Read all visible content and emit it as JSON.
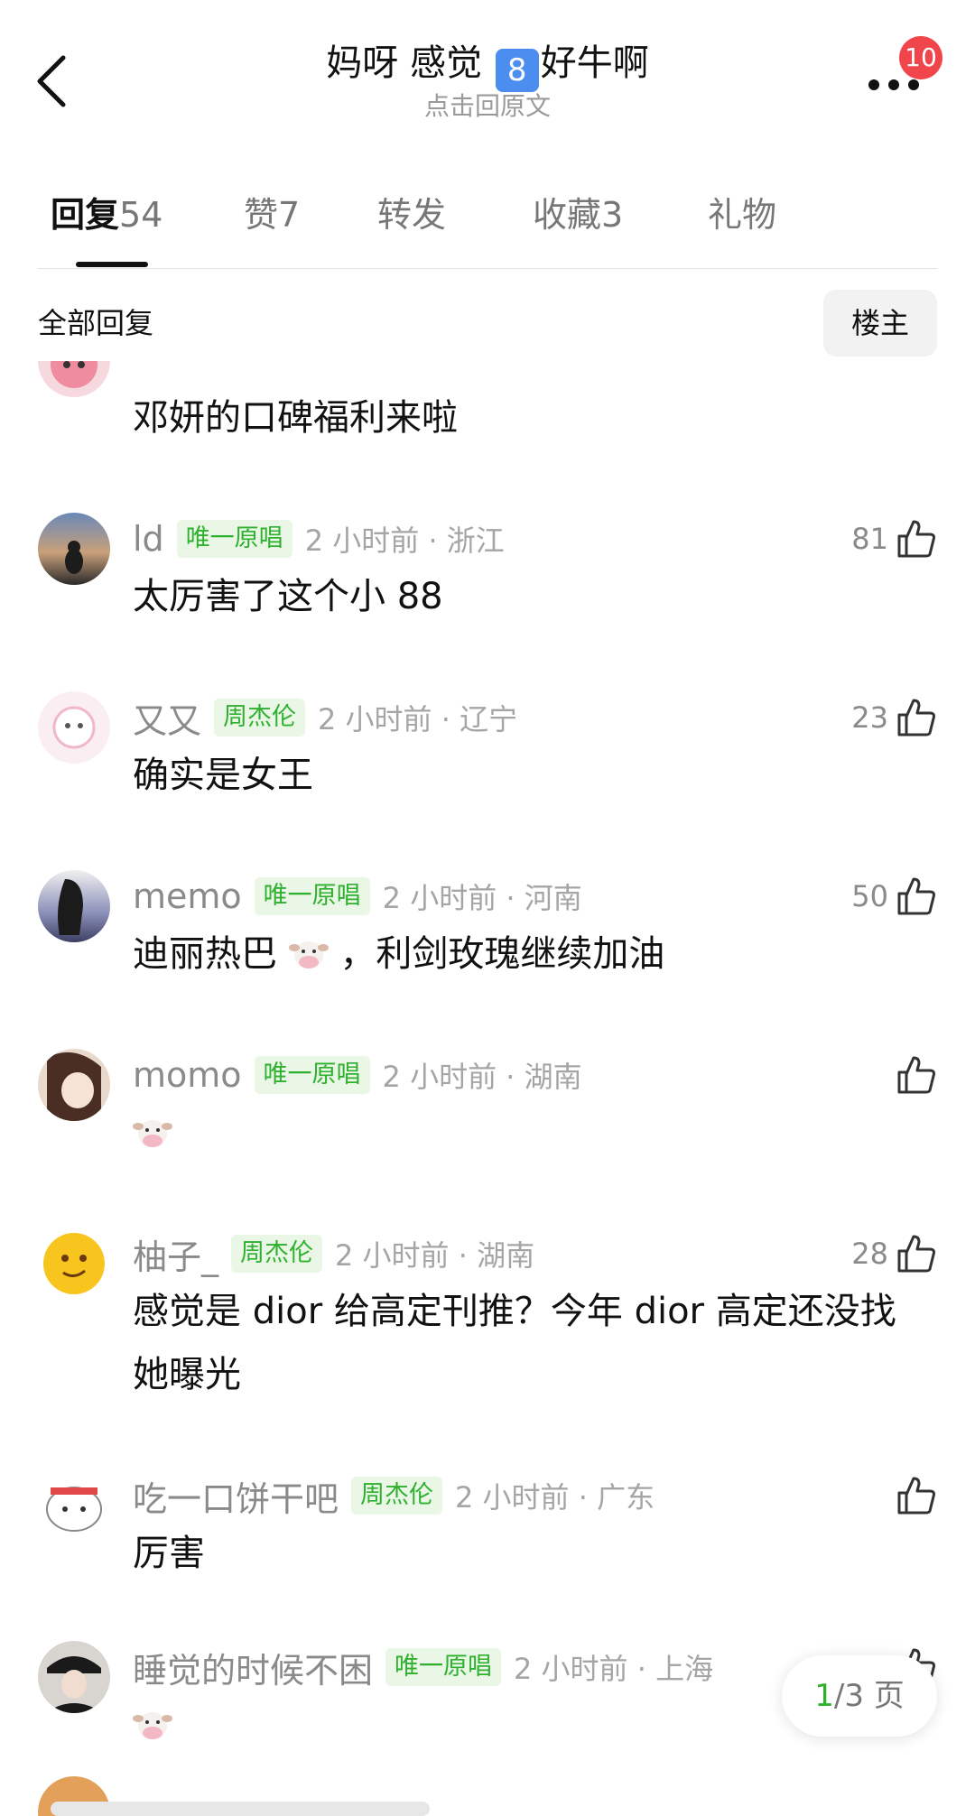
{
  "header": {
    "title_before": "妈呀 感觉",
    "title_badge": "8",
    "title_after": "好牛啊",
    "subtitle": "点击回原文",
    "notification_count": "10"
  },
  "tabs": [
    {
      "label": "回复",
      "count": "54"
    },
    {
      "label": "赞",
      "count": "7"
    },
    {
      "label": "转发",
      "count": ""
    },
    {
      "label": "收藏",
      "count": "3"
    },
    {
      "label": "礼物",
      "count": ""
    }
  ],
  "section": {
    "title": "全部回复",
    "op_filter": "楼主"
  },
  "comments": [
    {
      "text": "邓妍的口碑福利来啦"
    },
    {
      "name": "ld",
      "tag": "唯一原唱",
      "time": "2 小时前 · 浙江",
      "likes": "81",
      "text": "太厉害了这个小 88"
    },
    {
      "name": "又又",
      "tag": "周杰伦",
      "time": "2 小时前 · 辽宁",
      "likes": "23",
      "text": "确实是女王"
    },
    {
      "name": "memo",
      "tag": "唯一原唱",
      "time": "2 小时前 · 河南",
      "likes": "50",
      "text_before": "迪丽热巴",
      "text_after": "，利剑玫瑰继续加油"
    },
    {
      "name": "momo",
      "tag": "唯一原唱",
      "time": "2 小时前 · 湖南",
      "likes": ""
    },
    {
      "name": "柚子_",
      "tag": "周杰伦",
      "time": "2 小时前 · 湖南",
      "likes": "28",
      "text": "感觉是 dior 给高定刊推？今年 dior 高定还没找她曝光"
    },
    {
      "name": "吃一口饼干吧",
      "tag": "周杰伦",
      "time": "2 小时前 · 广东",
      "likes": "",
      "text": "厉害"
    },
    {
      "name": "睡觉的时候不困",
      "tag": "唯一原唱",
      "time": "2 小时前 · 上海",
      "likes": ""
    }
  ],
  "pager": {
    "current": "1",
    "total": "/3 页"
  },
  "colors": {
    "tag_bg": "#eaf7e6",
    "tag_text": "#2fb12f",
    "badge": "#f0454a"
  }
}
